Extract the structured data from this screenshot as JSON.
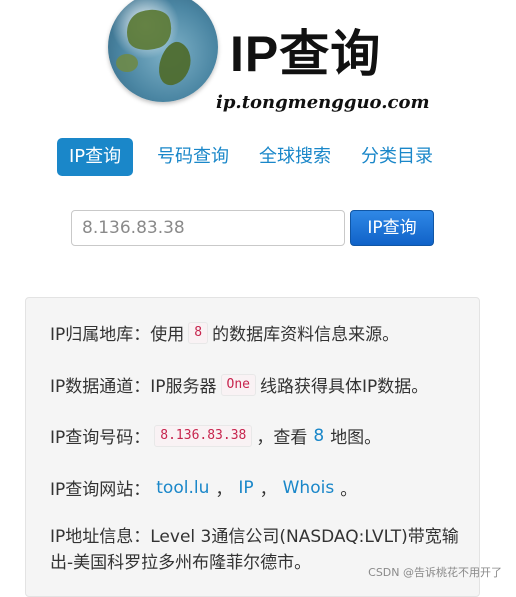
{
  "logo": {
    "title": "IP查询",
    "subtitle": "ip.tongmengguo.com"
  },
  "nav": {
    "items": [
      {
        "label": "IP查询",
        "active": true
      },
      {
        "label": "号码查询",
        "active": false
      },
      {
        "label": "全球搜索",
        "active": false
      },
      {
        "label": "分类目录",
        "active": false
      }
    ]
  },
  "search": {
    "value": "8.136.83.38",
    "button_label": "IP查询"
  },
  "results": {
    "location": {
      "prefix": "IP归属地库：使用",
      "badge": "8",
      "suffix": "的数据库资料信息来源。"
    },
    "channel": {
      "prefix": "IP数据通道：IP服务器",
      "badge": "One",
      "suffix": "线路获得具体IP数据。"
    },
    "query_code": {
      "prefix": "IP查询号码：",
      "badge": "8.136.83.38",
      "middle": "，查看",
      "link": "8",
      "suffix": "地图。"
    },
    "sites": {
      "prefix": "IP查询网站：",
      "links": [
        "tool.lu",
        "IP",
        "Whois"
      ],
      "sep": "，",
      "end": "。"
    },
    "address": {
      "text": "IP地址信息：Level 3通信公司(NASDAQ:LVLT)带宽输出-美国科罗拉多州布隆菲尔德市。"
    }
  },
  "watermark": "CSDN @告诉桃花不用开了",
  "colors": {
    "link": "#1a87c9",
    "button": "#1062c8",
    "code_text": "#c7254e",
    "panel_bg": "#f5f5f5"
  }
}
